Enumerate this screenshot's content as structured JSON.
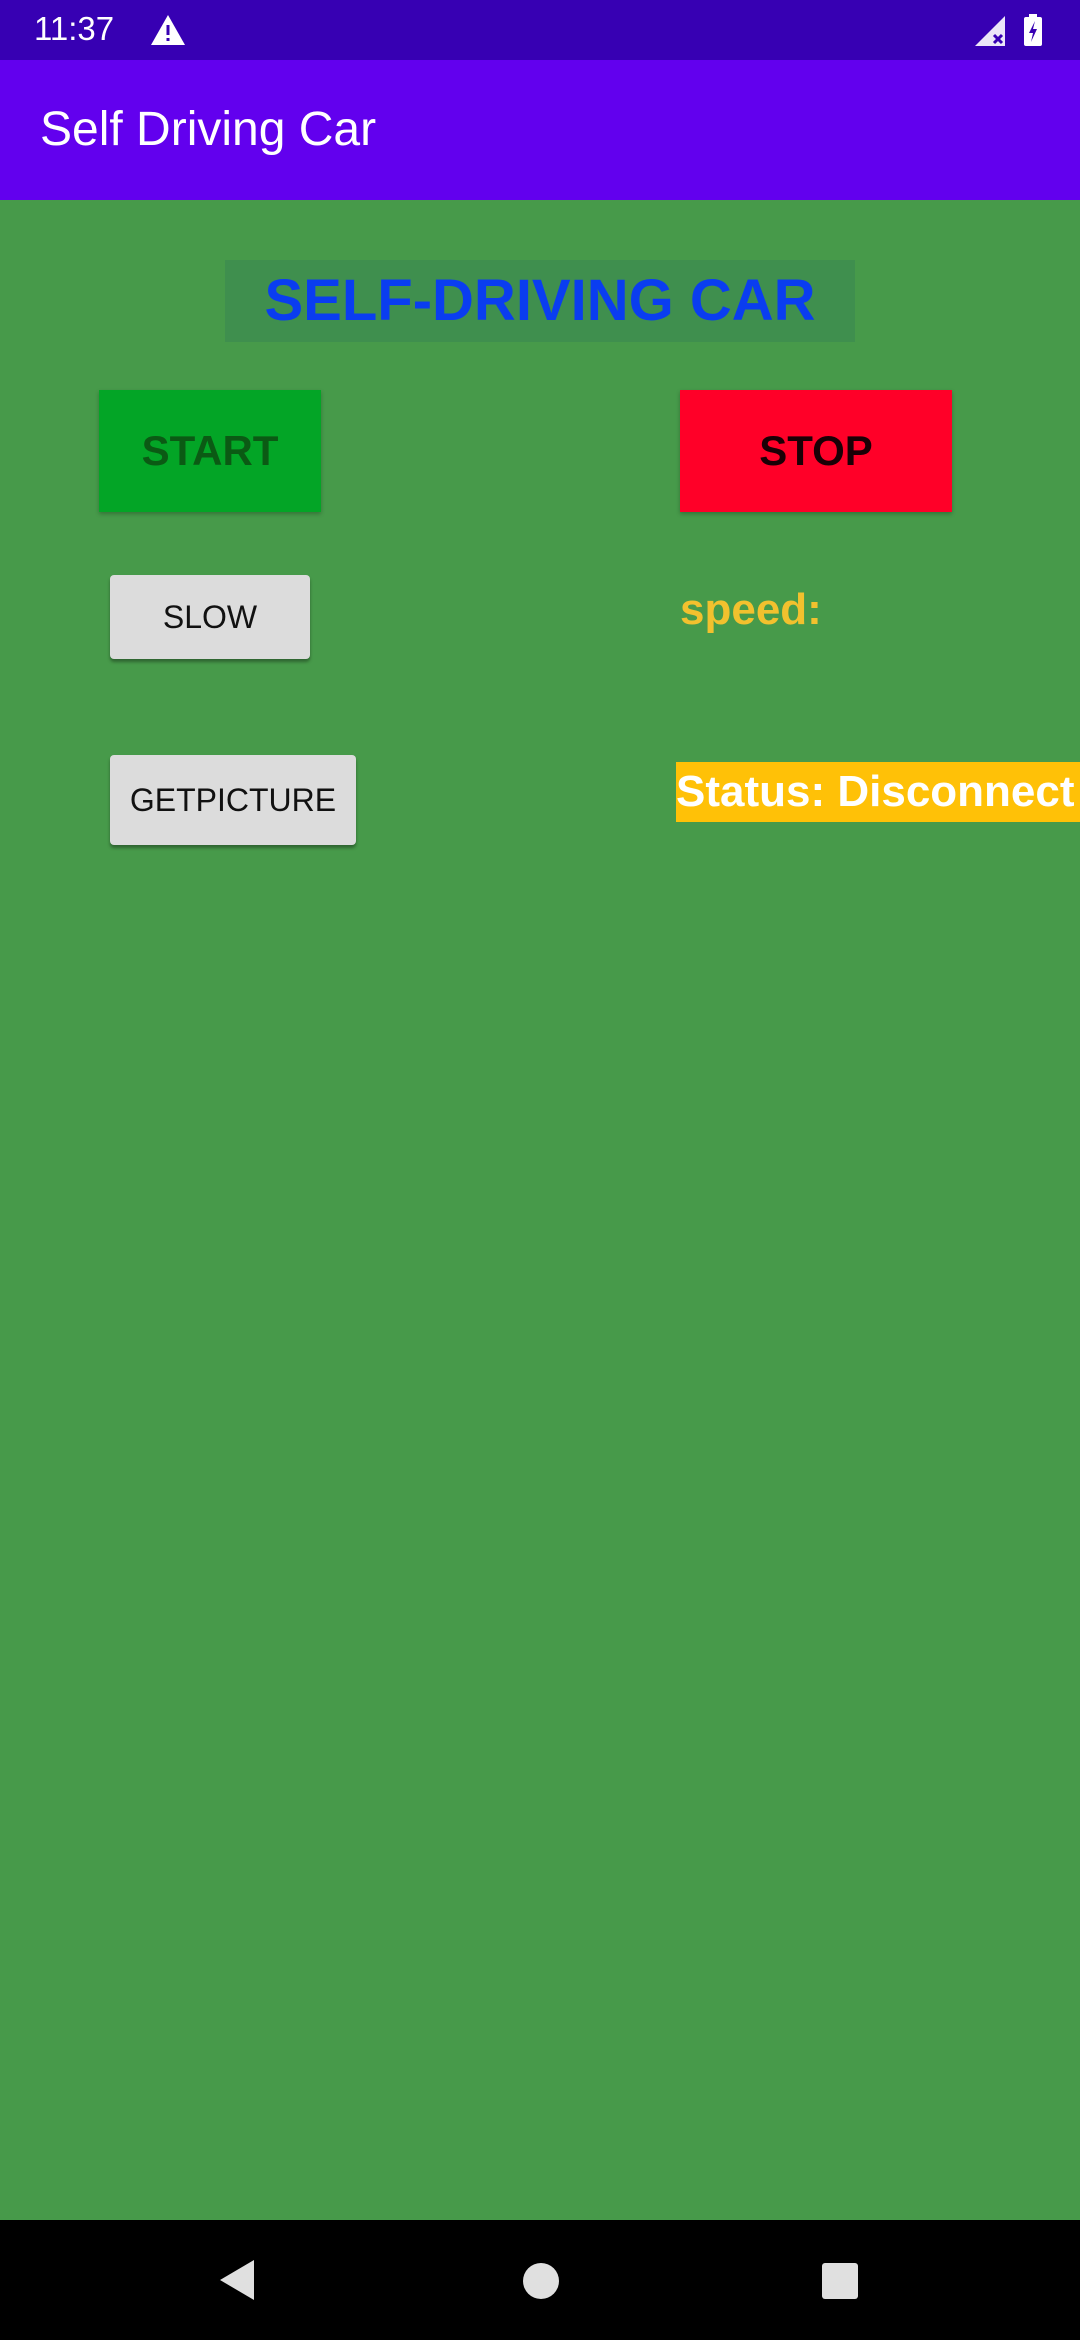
{
  "status_bar": {
    "time": "11:37",
    "icons": [
      "warning-icon",
      "signal-icon",
      "battery-icon"
    ]
  },
  "app_bar": {
    "title": "Self Driving Car",
    "color": "#6200ee"
  },
  "main": {
    "header": "SELF-DRIVING CAR",
    "buttons": {
      "start": "START",
      "stop": "STOP",
      "slow": "SLOW",
      "getpicture": "GETPICTURE"
    },
    "speed_label": "speed:",
    "status_label": "Status: Disconnect !",
    "colors": {
      "background": "#479a4a",
      "start": "#03a526",
      "stop": "#ff0028",
      "status_bg": "#ffc107",
      "speed_text": "#f2c12e",
      "header_text": "#0a3df0"
    }
  },
  "nav_bar": {
    "icons": [
      "back-icon",
      "home-icon",
      "recents-icon"
    ]
  }
}
